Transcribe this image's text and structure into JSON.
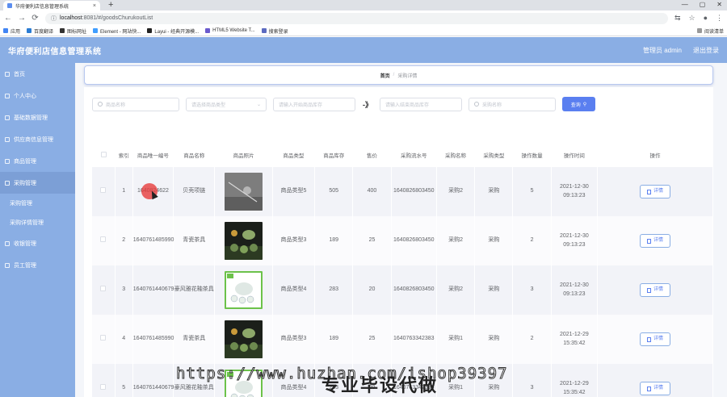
{
  "browser": {
    "tab_title": "华府便利店信息管理系统",
    "tab_close": "×",
    "new_tab": "+",
    "win_min": "—",
    "win_max": "▢",
    "win_close": "✕",
    "back": "←",
    "forward": "→",
    "reload": "⟳",
    "url_host": "localhost",
    "url_path": ":8081/#/goodsChurukoutList",
    "bookmarks": [
      "应用",
      "百度翻译",
      "图标网址",
      "Element - 网站快...",
      "Layui - 经典开源模...",
      "HTML5 Website T...",
      "搜索登录"
    ],
    "reading_list": "阅读清单"
  },
  "header": {
    "title": "华府便利店信息管理系统",
    "admin": "管理员 admin",
    "logout": "退出登录"
  },
  "sidebar": {
    "items": [
      {
        "label": "首页",
        "sub": false,
        "active": false
      },
      {
        "label": "个人中心",
        "sub": false,
        "active": false
      },
      {
        "label": "基础数据管理",
        "sub": false,
        "active": false
      },
      {
        "label": "供应商信息管理",
        "sub": false,
        "active": false
      },
      {
        "label": "商品管理",
        "sub": false,
        "active": false
      },
      {
        "label": "采购管理",
        "sub": false,
        "active": true
      },
      {
        "label": "采购管理",
        "sub": true,
        "active": false
      },
      {
        "label": "采购详情管理",
        "sub": true,
        "active": false
      },
      {
        "label": "收银管理",
        "sub": false,
        "active": false
      },
      {
        "label": "员工管理",
        "sub": false,
        "active": false
      }
    ]
  },
  "breadcrumb": {
    "home": "首页",
    "sep": "/",
    "current": "采购详情"
  },
  "filters": {
    "name_placeholder": "商品名称",
    "type_placeholder": "请选择商品类型",
    "stock_min_placeholder": "请输入开始商品库存",
    "arrow": "-》",
    "stock_max_placeholder": "请输入结束商品库存",
    "purchase_name_placeholder": "采购名称",
    "search_label": "查询"
  },
  "table": {
    "columns": [
      "",
      "索引",
      "商品唯一编号",
      "商品名称",
      "商品照片",
      "商品类型",
      "商品库存",
      "售价",
      "采购流水号",
      "采购名称",
      "采购类型",
      "操作数量",
      "操作时间",
      "操作"
    ],
    "detail_label": "详情",
    "rows": [
      {
        "index": "1",
        "code": "1640824622",
        "name": "贝壳项链",
        "thumb": "grey",
        "type": "商品类型5",
        "stock": "505",
        "price": "400",
        "serial": "1640826803450",
        "pname": "采购2",
        "ptype": "采购",
        "qty": "5",
        "time_date": "2021-12-30",
        "time_clock": "09:13:23"
      },
      {
        "index": "2",
        "code": "1640761485990",
        "name": "青瓷茶具",
        "thumb": "dark",
        "type": "商品类型3",
        "stock": "189",
        "price": "25",
        "serial": "1640826803450",
        "pname": "采购2",
        "ptype": "采购",
        "qty": "2",
        "time_date": "2021-12-30",
        "time_clock": "09:13:23"
      },
      {
        "index": "3",
        "code": "1640761440679",
        "name": "豪风雅花釉茶具",
        "thumb": "green",
        "type": "商品类型4",
        "stock": "283",
        "price": "20",
        "serial": "1640826803450",
        "pname": "采购2",
        "ptype": "采购",
        "qty": "3",
        "time_date": "2021-12-30",
        "time_clock": "09:13:23"
      },
      {
        "index": "4",
        "code": "1640761485990",
        "name": "青瓷茶具",
        "thumb": "dark",
        "type": "商品类型3",
        "stock": "189",
        "price": "25",
        "serial": "1640763342383",
        "pname": "采购1",
        "ptype": "采购",
        "qty": "2",
        "time_date": "2021-12-29",
        "time_clock": "15:35:42"
      },
      {
        "index": "5",
        "code": "1640761440679",
        "name": "豪风雅花釉茶具",
        "thumb": "green",
        "type": "商品类型4",
        "stock": "283",
        "price": "20",
        "serial": "1640763342383",
        "pname": "采购1",
        "ptype": "采购",
        "qty": "3",
        "time_date": "2021-12-29",
        "time_clock": "15:35:42"
      }
    ]
  },
  "watermark": {
    "url": "https://www.huzhan.com/ishop39397",
    "slogan": "专业毕设代做"
  },
  "colors": {
    "header_bg": "#8aaee4",
    "accent": "#5a7ff0"
  }
}
